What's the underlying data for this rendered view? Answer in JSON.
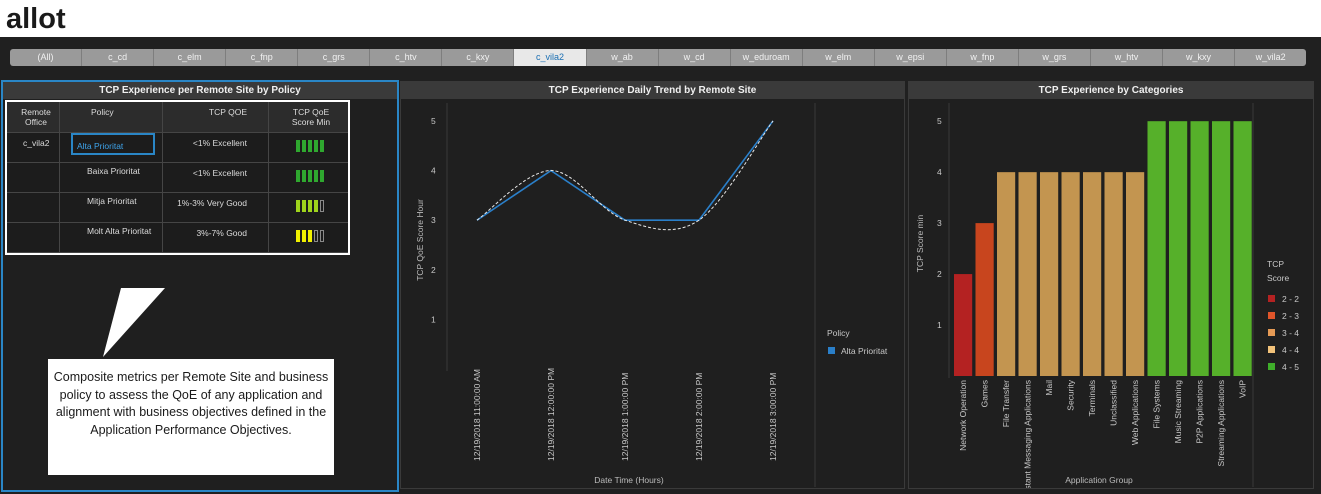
{
  "logo": {
    "text": "allot"
  },
  "tabs": [
    "(All)",
    "c_cd",
    "c_elm",
    "c_fnp",
    "c_grs",
    "c_htv",
    "c_kxy",
    "c_vila2",
    "w_ab",
    "w_cd",
    "w_eduroam",
    "w_elm",
    "w_epsi",
    "w_fnp",
    "w_grs",
    "w_htv",
    "w_kxy",
    "w_vila2"
  ],
  "active_tab": "c_vila2",
  "panel1": {
    "title": "TCP Experience per Remote Site by Policy",
    "headers": {
      "remote_office": "Remote Office",
      "policy": "Policy",
      "tcp_qoe": "TCP QOE",
      "score_min": "TCP QoE Score Min"
    },
    "rows": [
      {
        "remote_office": "c_vila2",
        "policy": "Alta Prioritat",
        "tcp_qoe": "<1% Excellent",
        "score": 5,
        "color": "#2fa82f"
      },
      {
        "remote_office": "",
        "policy": "Baixa Prioritat",
        "tcp_qoe": "<1% Excellent",
        "score": 5,
        "color": "#2fa82f"
      },
      {
        "remote_office": "",
        "policy": "Mitja Prioritat",
        "tcp_qoe": "1%-3% Very Good",
        "score": 4,
        "color": "#9fd41c"
      },
      {
        "remote_office": "",
        "policy": "Molt Alta Prioritat",
        "tcp_qoe": "3%-7% Good",
        "score": 3,
        "color": "#f0f000"
      }
    ],
    "callout": "Composite metrics per Remote Site and business policy to assess the QoE of any application and alignment with business objectives defined in the Application Performance Objectives."
  },
  "panel2": {
    "title": "TCP Experience Daily Trend by Remote Site",
    "legend_title": "Policy",
    "legend_item": "Alta Prioritat",
    "legend_color": "#2a7fc9"
  },
  "panel3": {
    "title": "TCP Experience by Categories",
    "legend_title_1": "TCP",
    "legend_title_2": "Score"
  },
  "chart_data": [
    {
      "type": "line",
      "title": "TCP Experience Daily Trend by Remote Site",
      "xlabel": "Date Time (Hours)",
      "ylabel": "TCP QoE Score Hour",
      "x": [
        "12/19/2018 11:00:00 AM",
        "12/19/2018 12:00:00 PM",
        "12/19/2018 1:00:00 PM",
        "12/19/2018 2:00:00 PM",
        "12/19/2018 3:00:00 PM"
      ],
      "series": [
        {
          "name": "Alta Prioritat",
          "values": [
            3,
            4,
            3,
            3,
            5
          ]
        }
      ],
      "ylim": [
        0,
        5
      ],
      "yticks": [
        1,
        2,
        3,
        4,
        5
      ],
      "trendline": true
    },
    {
      "type": "bar",
      "title": "TCP Experience by Categories",
      "xlabel": "Application Group",
      "ylabel": "TCP Score min",
      "ylim": [
        0,
        5
      ],
      "yticks": [
        1,
        2,
        3,
        4,
        5
      ],
      "categories": [
        "Network Operation",
        "Games",
        "File Transfer",
        "Instant Messaging Applications",
        "Mail",
        "Security",
        "Terminals",
        "Unclassified",
        "Web Applications",
        "File Systems",
        "Music Streaming",
        "P2P Applications",
        "Streaming Applications",
        "VoIP"
      ],
      "values": [
        2,
        3,
        4,
        4,
        4,
        4,
        4,
        4,
        4,
        5,
        5,
        5,
        5,
        5
      ],
      "legend": [
        {
          "label": "2 - 2",
          "color": "#b42222"
        },
        {
          "label": "2 - 3",
          "color": "#e0552a"
        },
        {
          "label": "3 - 4",
          "color": "#e59a55"
        },
        {
          "label": "4 - 4",
          "color": "#f2c27a"
        },
        {
          "label": "4 - 5",
          "color": "#3fae2a"
        }
      ],
      "bar_colors": [
        "#b42222",
        "#c8451e",
        "#c39550",
        "#c39550",
        "#c39550",
        "#c39550",
        "#c39550",
        "#c39550",
        "#c39550",
        "#56b02a",
        "#56b02a",
        "#56b02a",
        "#56b02a",
        "#56b02a"
      ]
    }
  ]
}
